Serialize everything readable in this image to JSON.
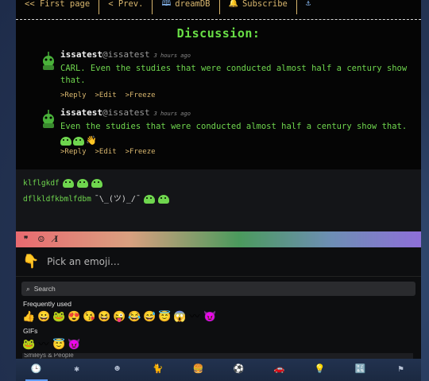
{
  "nav": {
    "first_page": "<< First page",
    "prev": "< Prev.",
    "db": "dreamDB",
    "subscribe": "Subscribe",
    "db_icon": "book-icon",
    "bell_icon": "bell-icon",
    "anchor_icon": "anchor-icon"
  },
  "discussion": {
    "title": "Discussion:",
    "comments": [
      {
        "user": "issatest",
        "handle": "@issatest",
        "time": "3 hours ago",
        "text": "CARL. Even the studies that were conducted almost half a century show that.",
        "reply": ">Reply",
        "edit": ">Edit",
        "freeze": ">Freeze"
      },
      {
        "user": "issatest",
        "handle": "@issatest",
        "time": "3 hours ago",
        "text": "Even the studies that were conducted almost half a century show that.",
        "reply": ">Reply",
        "edit": ">Edit",
        "freeze": ">Freeze"
      }
    ]
  },
  "compose": {
    "line1": "klflgkdf",
    "line2": "dflkldfkbmlfdbm",
    "shrug": "¯\\_(ツ)_/¯"
  },
  "toolbar": {
    "quote": "❞",
    "emoji": "☺",
    "clear": "I̸"
  },
  "picker": {
    "prompt": "Pick an emoji…",
    "search_placeholder": "Search",
    "frequently_used": "Frequently used",
    "gifs": "GIFs",
    "next_category": "Smileys & People",
    "frequent": [
      "👍",
      "😀",
      "🐸",
      "😍",
      "😘",
      "😆",
      "😜",
      "😂",
      "😅",
      "😇",
      "😱",
      "〰",
      "😈"
    ],
    "gif_items": [
      "🐸",
      "〰",
      "😇",
      "😈"
    ]
  },
  "categories": [
    "🕒",
    "✱",
    "☻",
    "🐈",
    "🍔",
    "⚽",
    "🚗",
    "💡",
    "🔣",
    "⚑"
  ]
}
